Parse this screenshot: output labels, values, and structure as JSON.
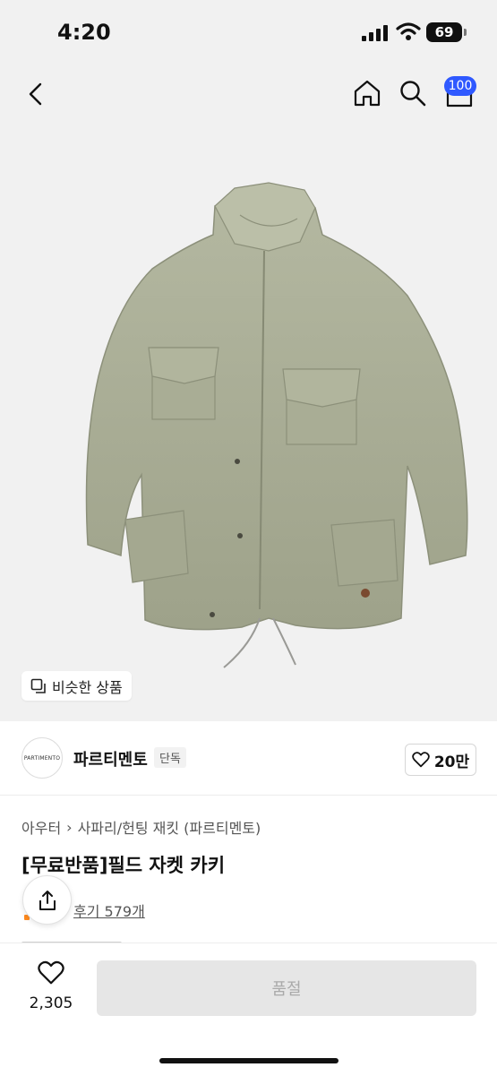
{
  "status_bar": {
    "time": "4:20",
    "battery": "69"
  },
  "header": {
    "cart_badge": "100"
  },
  "hero": {
    "similar_label": "비슷한 상품"
  },
  "brand": {
    "logo_text": "PARTIMENTO",
    "name": "파르티멘토",
    "tag": "단독",
    "likes": "20만"
  },
  "product": {
    "breadcrumb": [
      "아우터",
      "사파리/헌팅 재킷 (파르티멘토)"
    ],
    "title": "[무료반품]필드 자켓 카키",
    "reviews": "후기 579개",
    "jacket_color": "#a8ac94"
  },
  "bottom_bar": {
    "like_count": "2,305",
    "buy_label": "품절"
  }
}
